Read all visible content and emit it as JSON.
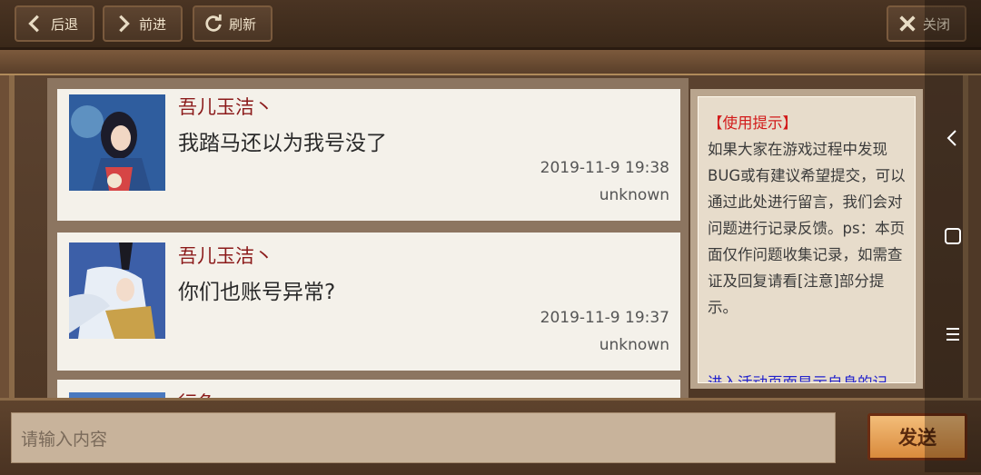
{
  "toolbar": {
    "back_label": "后退",
    "forward_label": "前进",
    "refresh_label": "刷新",
    "close_label": "关闭"
  },
  "messages": [
    {
      "user": "吾儿玉洁丶",
      "text": "我踏马还以为我号没了",
      "time": "2019-11-9 19:38",
      "status": "unknown"
    },
    {
      "user": "吾儿玉洁丶",
      "text": "你们也账号异常?",
      "time": "2019-11-9 19:37",
      "status": "unknown"
    },
    {
      "user": "行鱼",
      "text": "",
      "time": "",
      "status": ""
    }
  ],
  "tips": {
    "title": "【使用提示】",
    "body": "如果大家在游戏过程中发现BUG或有建议希望提交，可以通过此处进行留言，我们会对问题进行记录反馈。ps：本页面仅作问题收集记录，如需查证及回复请看[注意]部分提示。",
    "link": "进入活动页面显示自身的记"
  },
  "input": {
    "placeholder": "请输入内容"
  },
  "send_label": "发送",
  "icons": {
    "back": "chevron-left-icon",
    "forward": "chevron-right-icon",
    "refresh": "refresh-icon",
    "close": "close-x-icon"
  },
  "colors": {
    "username": "#8b1a1a",
    "tips_title": "#d21a1a",
    "link": "#2222cc",
    "send_bg": "#e9a55a"
  }
}
